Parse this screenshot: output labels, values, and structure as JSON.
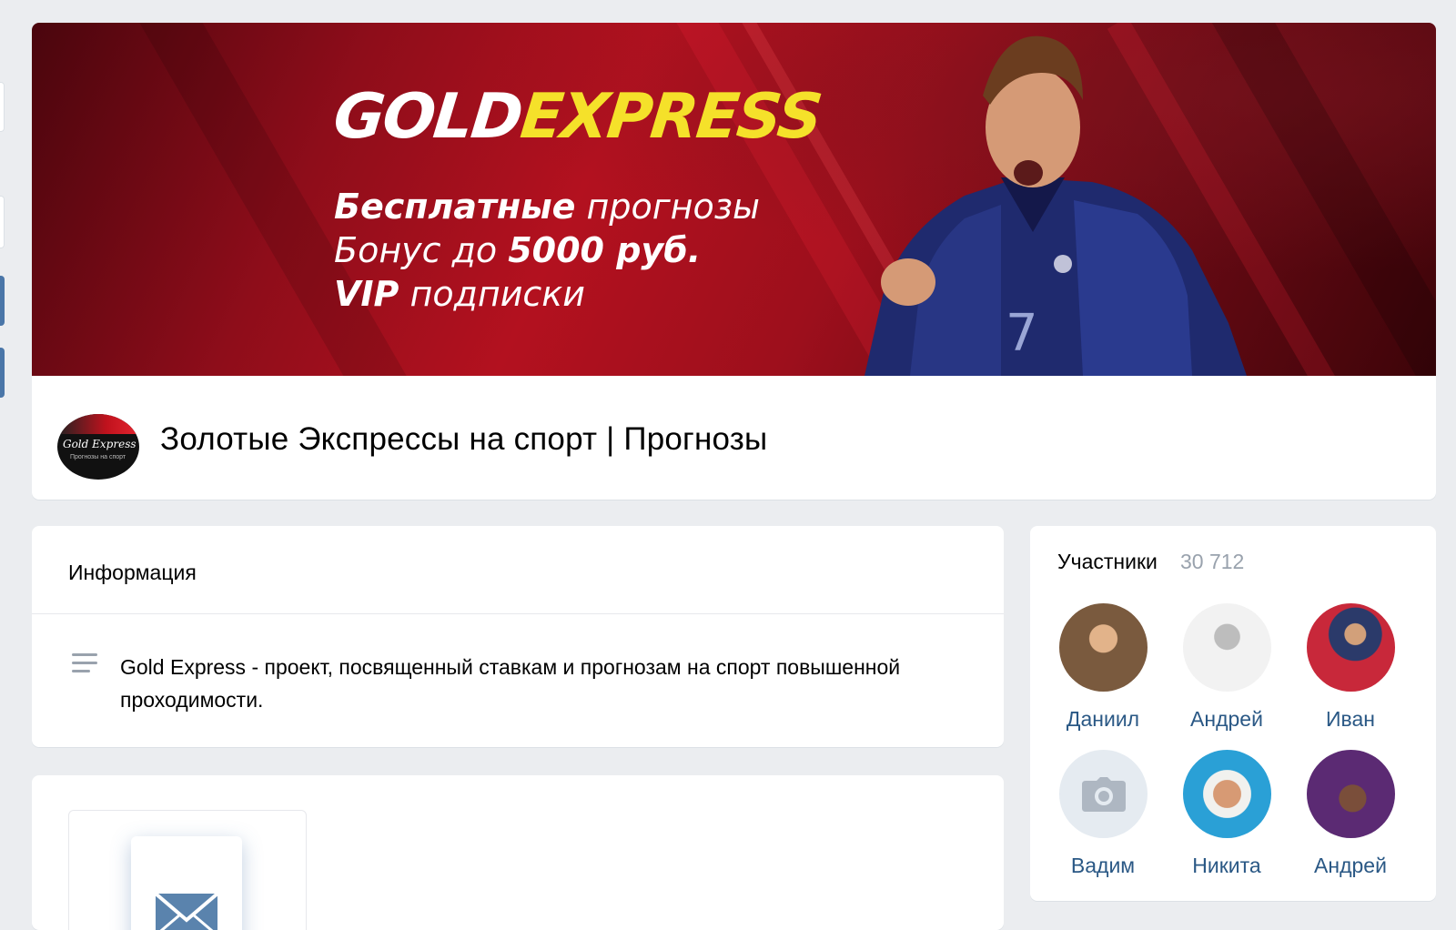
{
  "cover": {
    "logo_part1": "GOLD",
    "logo_part2": "EXPRESS",
    "line1_bold": "Бесплатные",
    "line1_light": " прогнозы",
    "line2_light": "Бонус до ",
    "line2_bold": "5000 руб.",
    "line3_bold": "VIP",
    "line3_light": " подписки"
  },
  "group": {
    "title": "Золотые Экспрессы на спорт | Прогнозы",
    "avatar_text": "Gold Express",
    "avatar_subtext": "Прогнозы на спорт"
  },
  "info": {
    "title": "Информация",
    "description": "Gold Express - проект, посвященный ставкам и прогнозам на спорт повышенной проходимости."
  },
  "contacts": {
    "icon": "mail-icon"
  },
  "members": {
    "title": "Участники",
    "count": "30 712",
    "items": [
      {
        "name": "Даниил"
      },
      {
        "name": "Андрей"
      },
      {
        "name": "Иван"
      },
      {
        "name": "Вадим"
      },
      {
        "name": "Никита"
      },
      {
        "name": "Андрей"
      }
    ]
  },
  "colors": {
    "accent": "#4a76a8",
    "link": "#2a5885",
    "muted": "#99a2ad",
    "background": "#ebedf0",
    "logo_yellow": "#f5e12a"
  }
}
